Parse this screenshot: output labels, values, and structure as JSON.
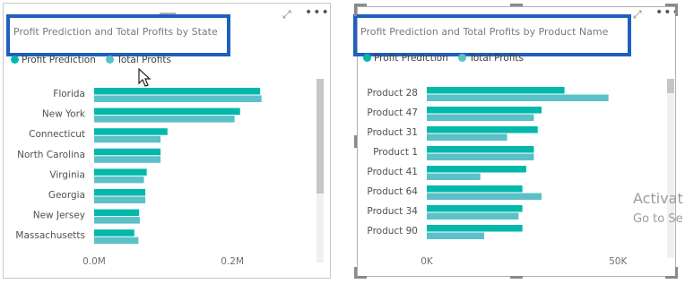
{
  "colors": {
    "profit_prediction": "#01b8aa",
    "total_profits": "#5bc0c8"
  },
  "visual1": {
    "title": "Profit Prediction and Total Profits by State",
    "legend": [
      "Profit Prediction",
      "Total Profits"
    ]
  },
  "visual2": {
    "title": "Profit Prediction and Total Profits by Product Name",
    "legend": [
      "Profit Prediction",
      "Total Profits"
    ]
  },
  "watermark": {
    "line1": "Activat",
    "line2": "Go to Se"
  },
  "chart_data": [
    {
      "type": "bar",
      "orientation": "horizontal",
      "title": "Profit Prediction and Total Profits by State",
      "categories": [
        "Florida",
        "New York",
        "Connecticut",
        "North Carolina",
        "Virginia",
        "Georgia",
        "New Jersey",
        "Massachusetts"
      ],
      "series": [
        {
          "name": "Profit Prediction",
          "values": [
            240000,
            211000,
            106000,
            96000,
            76000,
            74000,
            65000,
            58000
          ]
        },
        {
          "name": "Total Profits",
          "values": [
            242000,
            203000,
            96000,
            96000,
            72000,
            74000,
            66000,
            64000
          ]
        }
      ],
      "x_ticks": [
        "0.0M",
        "0.2M"
      ],
      "xlim": [
        0,
        0.35
      ],
      "xlim_units_value": [
        0,
        350000
      ],
      "legend_position": "top-left",
      "grid": false
    },
    {
      "type": "bar",
      "orientation": "horizontal",
      "title": "Profit Prediction and Total Profits by Product Name",
      "categories": [
        "Product 28",
        "Product 47",
        "Product 31",
        "Product 1",
        "Product 41",
        "Product 64",
        "Product 34",
        "Product 90"
      ],
      "series": [
        {
          "name": "Profit Prediction",
          "values": [
            36000,
            30000,
            29000,
            28000,
            26000,
            25000,
            25000,
            25000
          ]
        },
        {
          "name": "Total Profits",
          "values": [
            47500,
            28000,
            21000,
            28000,
            14000,
            30000,
            24000,
            15000
          ]
        }
      ],
      "x_ticks": [
        "0K",
        "50K"
      ],
      "xlim": [
        0,
        60000
      ],
      "legend_position": "top-left",
      "grid": false
    }
  ]
}
